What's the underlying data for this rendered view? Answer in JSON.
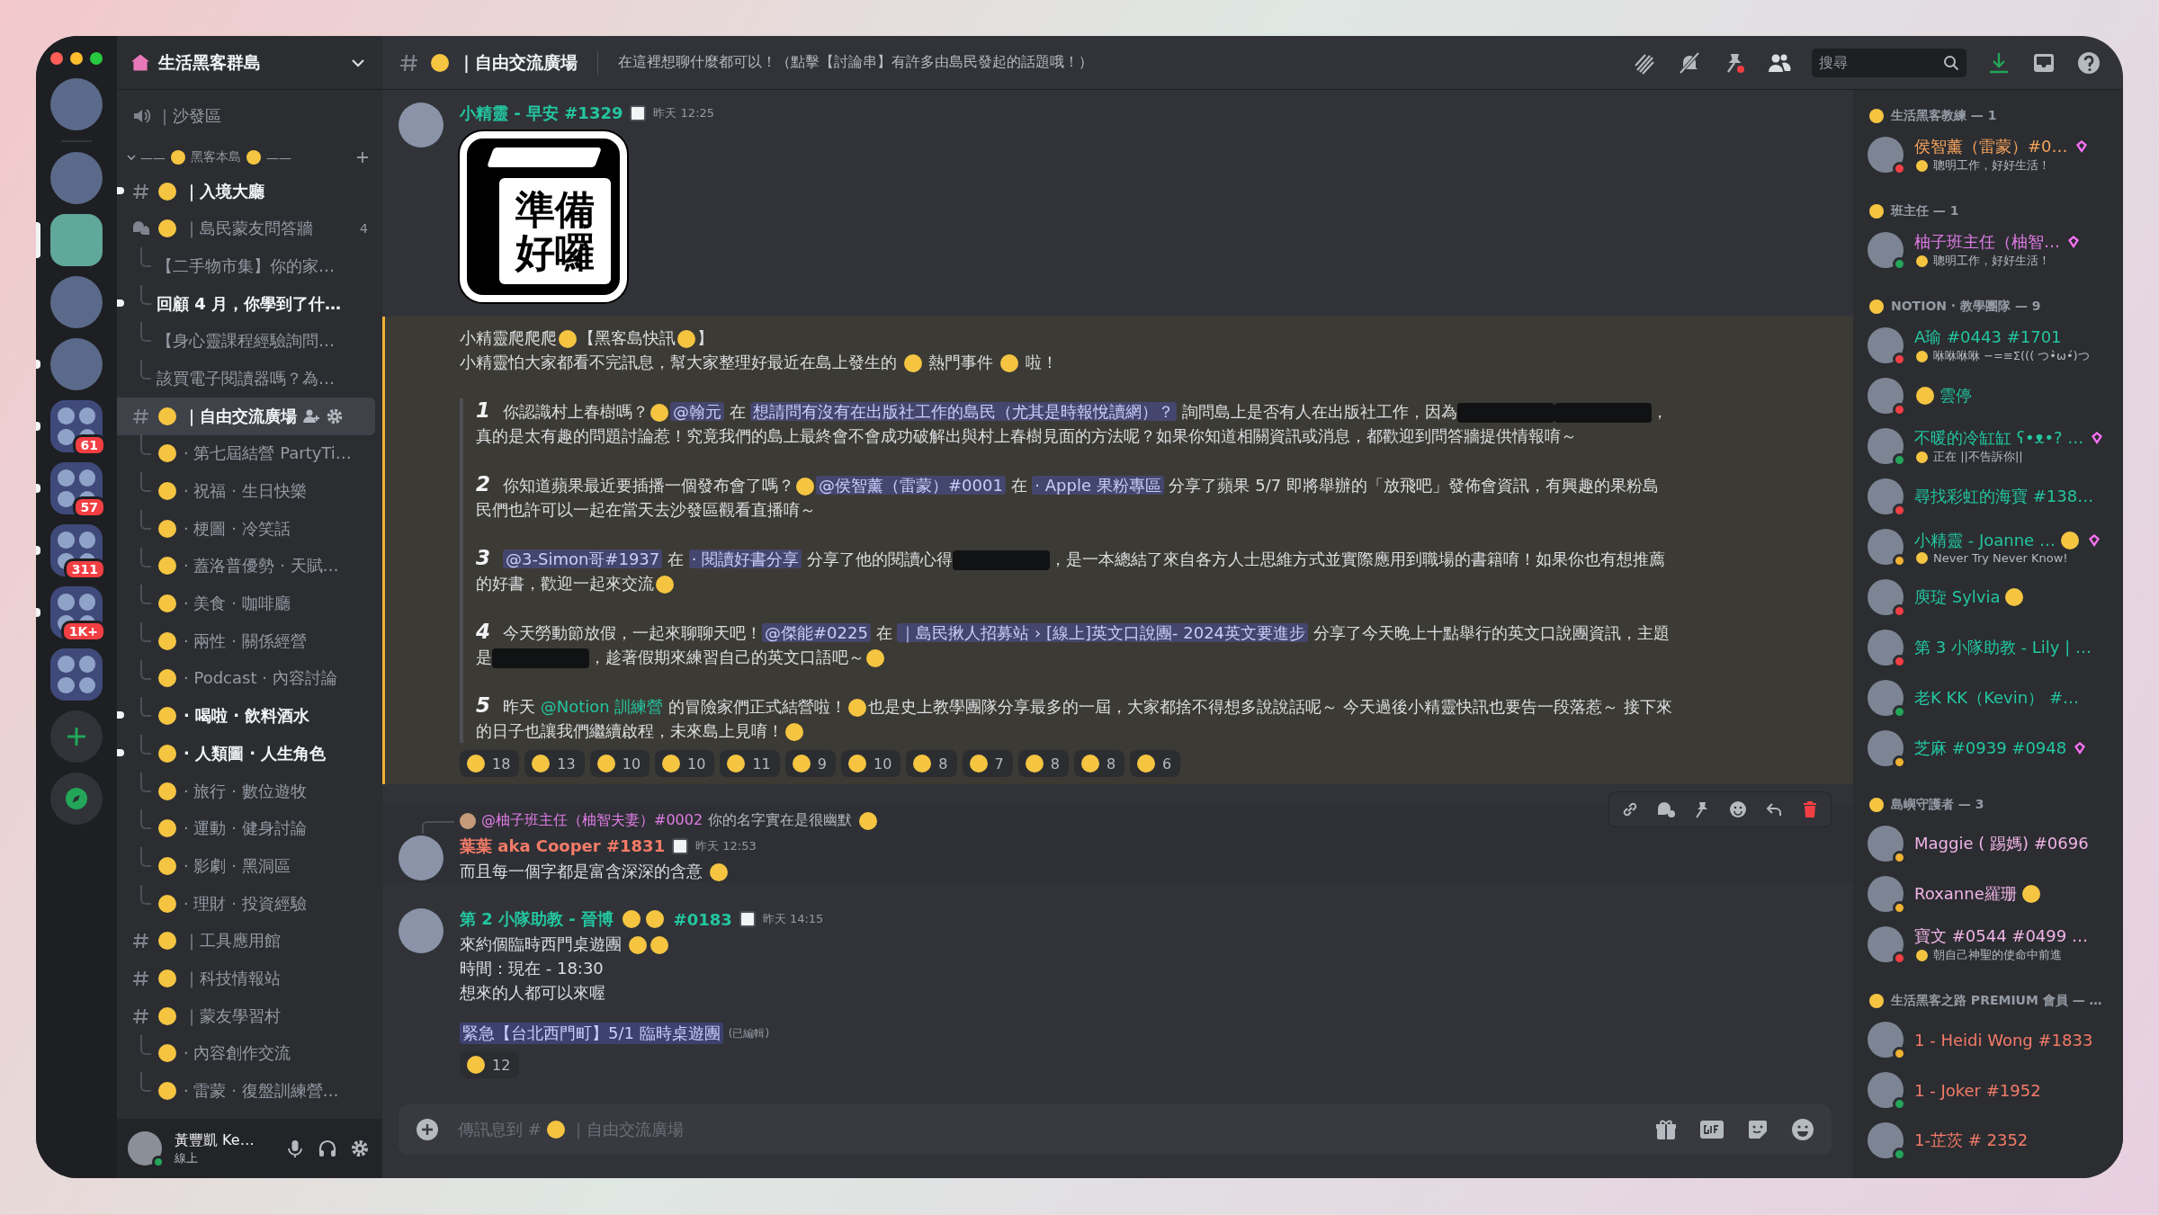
{
  "servers": [
    {
      "kind": "server",
      "selected": false,
      "unread": false
    },
    {
      "kind": "server",
      "selected": false,
      "unread": false
    },
    {
      "kind": "server",
      "selected": true,
      "unread": false
    },
    {
      "kind": "server",
      "selected": false,
      "unread": false
    },
    {
      "kind": "server",
      "selected": false,
      "unread": true
    },
    {
      "kind": "folder",
      "selected": false,
      "unread": true,
      "badge": "61"
    },
    {
      "kind": "folder",
      "selected": false,
      "unread": true,
      "badge": "57"
    },
    {
      "kind": "folder",
      "selected": false,
      "unread": true,
      "badge": "311"
    },
    {
      "kind": "folder",
      "selected": false,
      "unread": true,
      "badge": "1K+"
    },
    {
      "kind": "folder",
      "selected": false,
      "unread": false
    },
    {
      "kind": "add"
    },
    {
      "kind": "explore"
    }
  ],
  "guild": {
    "name": "生活黑客群島"
  },
  "channels": [
    {
      "kind": "voice",
      "emoji": false,
      "name": "｜沙發區",
      "unread": false,
      "selected": false
    },
    {
      "kind": "category",
      "prefix": "——",
      "name": "黑客本島",
      "suffix": "——"
    },
    {
      "kind": "text",
      "emoji": true,
      "name": "｜入境大廳",
      "unread": true,
      "selected": false
    },
    {
      "kind": "forum",
      "emoji": true,
      "name": "｜島民蒙友問答牆",
      "count": "4",
      "unread": false,
      "selected": false
    },
    {
      "kind": "thread",
      "emoji": false,
      "name": "【二手物市集】你的家…",
      "unread": false,
      "selected": false
    },
    {
      "kind": "thread",
      "emoji": false,
      "name": "回顧 4 月，你學到了什…",
      "unread": true,
      "selected": false
    },
    {
      "kind": "thread",
      "emoji": false,
      "name": "【身心靈課程經驗詢問…",
      "unread": false,
      "selected": false
    },
    {
      "kind": "thread",
      "emoji": false,
      "name": "該買電子閱讀器嗎？為…",
      "unread": false,
      "selected": false
    },
    {
      "kind": "text",
      "emoji": true,
      "name": "｜自由交流廣場",
      "unread": false,
      "selected": true
    },
    {
      "kind": "thread",
      "emoji": true,
      "name": "· 第七屆結營 PartyTi…",
      "unread": false,
      "selected": false
    },
    {
      "kind": "thread",
      "emoji": true,
      "name": "· 祝福 · 生日快樂",
      "unread": false,
      "selected": false
    },
    {
      "kind": "thread",
      "emoji": true,
      "name": "· 梗圖 · 冷笑話",
      "unread": false,
      "selected": false
    },
    {
      "kind": "thread",
      "emoji": true,
      "name": "· 蓋洛普優勢 · 天賦…",
      "unread": false,
      "selected": false
    },
    {
      "kind": "thread",
      "emoji": true,
      "name": "· 美食 · 咖啡廳",
      "unread": false,
      "selected": false
    },
    {
      "kind": "thread",
      "emoji": true,
      "name": "· 兩性 · 關係經營",
      "unread": false,
      "selected": false
    },
    {
      "kind": "thread",
      "emoji": true,
      "name": "· Podcast · 內容討論",
      "unread": false,
      "selected": false
    },
    {
      "kind": "thread",
      "emoji": true,
      "name": "· 喝啦 · 飲料酒水",
      "unread": true,
      "selected": false
    },
    {
      "kind": "thread",
      "emoji": true,
      "name": "· 人類圖 · 人生角色",
      "unread": true,
      "selected": false
    },
    {
      "kind": "thread",
      "emoji": true,
      "name": "· 旅行 · 數位遊牧",
      "unread": false,
      "selected": false
    },
    {
      "kind": "thread",
      "emoji": true,
      "name": "· 運動 · 健身討論",
      "unread": false,
      "selected": false
    },
    {
      "kind": "thread",
      "emoji": true,
      "name": "· 影劇 · 黑洞區",
      "unread": false,
      "selected": false
    },
    {
      "kind": "thread",
      "emoji": true,
      "name": "· 理財 · 投資經驗",
      "unread": false,
      "selected": false
    },
    {
      "kind": "text",
      "emoji": true,
      "name": "｜工具應用館",
      "unread": false,
      "selected": false
    },
    {
      "kind": "text",
      "emoji": true,
      "name": "｜科技情報站",
      "unread": false,
      "selected": false
    },
    {
      "kind": "text",
      "emoji": true,
      "name": "｜蒙友學習村",
      "unread": false,
      "selected": false
    },
    {
      "kind": "thread",
      "emoji": true,
      "name": "· 內容創作交流",
      "unread": false,
      "selected": false
    },
    {
      "kind": "thread",
      "emoji": true,
      "name": "· 雷蒙 · 復盤訓練營…",
      "unread": false,
      "selected": false
    }
  ],
  "user": {
    "name": "黃豐凱 Ke…",
    "status": "線上"
  },
  "header": {
    "channel": "｜自由交流廣場",
    "topic": "在這裡想聊什麼都可以！（點擊【討論串】有許多由島民發起的話題哦！）",
    "search": {
      "placeholder": "搜尋"
    }
  },
  "messages": [
    {
      "author": [
        {
          "kind": "text",
          "text": "小精靈 - 早安 #1329"
        }
      ],
      "color": "#23c6a0",
      "badge": true,
      "time": "昨天 12:25",
      "hovered": false,
      "mentioned": true,
      "sticker": {
        "lines": [
          "準備",
          "好囉"
        ]
      },
      "lines": [
        [
          {
            "kind": "text",
            "text": "小精靈爬爬爬"
          },
          {
            "kind": "emoji"
          },
          {
            "kind": "text",
            "text": "【黑客島快訊"
          },
          {
            "kind": "emoji"
          },
          {
            "kind": "text",
            "text": "】"
          }
        ],
        [
          {
            "kind": "text",
            "text": "小精靈怕大家都看不完訊息，幫大家整理好最近在島上發生的 "
          },
          {
            "kind": "emoji"
          },
          {
            "kind": "text",
            "text": " 熱門事件 "
          },
          {
            "kind": "emoji"
          },
          {
            "kind": "text",
            "text": " 啦！"
          }
        ]
      ],
      "quote": [
        {
          "number": "1",
          "segments": [
            {
              "kind": "text",
              "text": "你認識村上春樹嗎？"
            },
            {
              "kind": "emoji"
            },
            {
              "kind": "mention",
              "text": "@翰元"
            },
            {
              "kind": "text",
              "text": " 在 "
            },
            {
              "kind": "channel",
              "text": "想請問有沒有在出版社工作的島民（尤其是時報悅讀網）？"
            },
            {
              "kind": "text",
              "text": " 詢問島上是否有人在出版社工作，因為"
            },
            {
              "kind": "redacted"
            },
            {
              "kind": "redacted"
            },
            {
              "kind": "text",
              "text": "，真的是太有趣的問題討論惹！究竟我們的島上最終會不會成功破解出與村上春樹見面的方法呢？如果你知道相關資訊或消息，都歡迎到問答牆提供情報唷～"
            }
          ]
        },
        {
          "number": "2",
          "segments": [
            {
              "kind": "text",
              "text": "你知道蘋果最近要插播一個發布會了嗎？"
            },
            {
              "kind": "emoji"
            },
            {
              "kind": "mention",
              "text": "@侯智薰（雷蒙）#0001"
            },
            {
              "kind": "text",
              "text": " 在 "
            },
            {
              "kind": "channel",
              "text": "· Apple 果粉專區"
            },
            {
              "kind": "text",
              "text": " 分享了蘋果 5/7 即將舉辦的「放飛吧」發佈會資訊，有興趣的果粉島民們也許可以一起在當天去沙發區觀看直播唷～"
            }
          ]
        },
        {
          "number": "3",
          "segments": [
            {
              "kind": "mention",
              "text": "@3-Simon哥#1937"
            },
            {
              "kind": "text",
              "text": " 在 "
            },
            {
              "kind": "channel",
              "text": "· 閱讀好書分享"
            },
            {
              "kind": "text",
              "text": " 分享了他的閱讀心得"
            },
            {
              "kind": "redacted"
            },
            {
              "kind": "text",
              "text": "，是一本總結了來自各方人士思維方式並實際應用到職場的書籍唷！如果你也有想推薦的好書，歡迎一起來交流"
            },
            {
              "kind": "emoji"
            }
          ]
        },
        {
          "number": "4",
          "segments": [
            {
              "kind": "text",
              "text": "今天勞動節放假，一起來聊聊天吧！"
            },
            {
              "kind": "mention",
              "text": "@傑能#0225"
            },
            {
              "kind": "text",
              "text": " 在 "
            },
            {
              "kind": "channel",
              "text": "｜島民揪人招募站 › [線上]英文口說團- 2024英文要進步"
            },
            {
              "kind": "text",
              "text": " 分享了今天晚上十點舉行的英文口說團資訊，主題是"
            },
            {
              "kind": "redacted"
            },
            {
              "kind": "text",
              "text": "，趁著假期來練習自己的英文口語吧～"
            },
            {
              "kind": "emoji"
            }
          ]
        },
        {
          "number": "5",
          "segments": [
            {
              "kind": "text",
              "text": "昨天 "
            },
            {
              "kind": "role",
              "text": "@Notion 訓練營"
            },
            {
              "kind": "text",
              "text": " 的冒險家們正式結營啦！"
            },
            {
              "kind": "emoji"
            },
            {
              "kind": "text",
              "text": "也是史上教學團隊分享最多的一屆，大家都捨不得想多說說話呢～ 今天過後小精靈快訊也要告一段落惹～ 接下來的日子也讓我們繼續啟程，未來島上見唷！"
            },
            {
              "kind": "emoji"
            }
          ]
        }
      ],
      "reactions": [
        {
          "count": "18"
        },
        {
          "count": "13"
        },
        {
          "count": "10"
        },
        {
          "count": "10"
        },
        {
          "count": "11"
        },
        {
          "count": "9"
        },
        {
          "count": "10"
        },
        {
          "count": "8"
        },
        {
          "count": "7"
        },
        {
          "count": "8"
        },
        {
          "count": "8"
        },
        {
          "count": "6"
        }
      ]
    },
    {
      "reply": {
        "author": "@柚子班主任（柚智夫妻）#0002",
        "color": "#e07ce6",
        "text": "你的名字實在是很幽默"
      },
      "author": [
        {
          "kind": "text",
          "text": "葉葉 aka Cooper #1831"
        }
      ],
      "color": "#f47b67",
      "badge": true,
      "time": "昨天 12:53",
      "hovered": true,
      "mentioned": false,
      "lines": [
        [
          {
            "kind": "text",
            "text": "而且每一個字都是富含深深的含意 "
          },
          {
            "kind": "emoji"
          }
        ]
      ]
    },
    {
      "author": [
        {
          "kind": "text",
          "text": "第 2 小隊助教 - 晉博 "
        },
        {
          "kind": "emoji"
        },
        {
          "kind": "emoji"
        },
        {
          "kind": "text",
          "text": " #0183"
        }
      ],
      "color": "#23c6a0",
      "badge": true,
      "time": "昨天 14:15",
      "hovered": false,
      "mentioned": false,
      "lines": [
        [
          {
            "kind": "text",
            "text": "來約個臨時西門桌遊團 "
          },
          {
            "kind": "emoji"
          },
          {
            "kind": "emoji"
          }
        ],
        [
          {
            "kind": "text",
            "text": "時間：現在 - 18:30"
          }
        ],
        [
          {
            "kind": "text",
            "text": "想來的人都可以來喔"
          }
        ]
      ],
      "thread": {
        "text": "緊急【台北西門町】5/1 臨時桌遊團",
        "edited": "(已編輯)"
      },
      "reactions": [
        {
          "count": "12"
        }
      ]
    }
  ],
  "composer": {
    "prefix": "傳訊息到 #",
    "channel": "｜自由交流廣場"
  },
  "member_groups": [
    {
      "title": "生活黑客教練 — 1",
      "color": "#f6a45c",
      "members": [
        {
          "name": "侯智薰（雷蒙）#0…",
          "status": "聰明工作，好好生活！",
          "color": "#f23f43",
          "boost": true
        }
      ]
    },
    {
      "title": "班主任 — 1",
      "color": "#e07ce6",
      "members": [
        {
          "name": "柚子班主任（柚智…",
          "status": "聰明工作，好好生活！",
          "color": "#23a55a",
          "boost": true
        }
      ]
    },
    {
      "title": "NOTION · 教學團隊 — 9",
      "color": "#23c6a0",
      "members": [
        {
          "name": "A瑜 #0443 #1701",
          "status": "咻咻咻咻 −=≡Σ((( つ•̀ω•́)つ",
          "color": "#f23f43",
          "boost": false
        },
        {
          "name": "雲停",
          "emoji_before": true,
          "color": "#f23f43",
          "boost": false
        },
        {
          "name": "不暖的冷缸缸 ʕ•ᴥ•? …",
          "status": "正在 ||不告訴你||",
          "color": "#23a55a",
          "boost": true
        },
        {
          "name": "尋找彩虹的海寶 #138…",
          "color": "#f23f43",
          "boost": false
        },
        {
          "name": "小精靈 - Joanne …",
          "emoji_after": true,
          "status": "Never Try Never Know!",
          "color": "#f0b232",
          "boost": true
        },
        {
          "name": "庾琁 Sylvia",
          "emoji_after": true,
          "color": "#f23f43",
          "boost": false
        },
        {
          "name": "第 3 小隊助教 - Lily | …",
          "color": "#f23f43",
          "boost": false
        },
        {
          "name": "老K KK（Kevin） #…",
          "color": "#23a55a",
          "boost": false
        },
        {
          "name": "芝麻 #0939 #0948",
          "color": "#f0b232",
          "boost": true
        }
      ]
    },
    {
      "title": "島嶼守護者 — 3",
      "color": "#f1b4e6",
      "members": [
        {
          "name": "Maggie ( 踢媽) #0696",
          "color": "#f0b232",
          "boost": false
        },
        {
          "name": "Roxanne羅珊",
          "emoji_after": true,
          "color": "#f0b232",
          "boost": false
        },
        {
          "name": "寶文 #0544 #0499 …",
          "status": "朝自己神聖的使命中前進",
          "color": "#f23f43",
          "boost": false
        }
      ]
    },
    {
      "title": "生活黑客之路 PREMIUM 會員 — …",
      "color": "#f47b67",
      "members": [
        {
          "name": "1 - Heidi Wong #1833",
          "color": "#f0b232",
          "boost": false
        },
        {
          "name": "1 - Joker #1952",
          "color": "#23a55a",
          "boost": false
        },
        {
          "name": "1-芷茨 # 2352",
          "color": "#23a55a",
          "boost": false
        }
      ]
    }
  ]
}
